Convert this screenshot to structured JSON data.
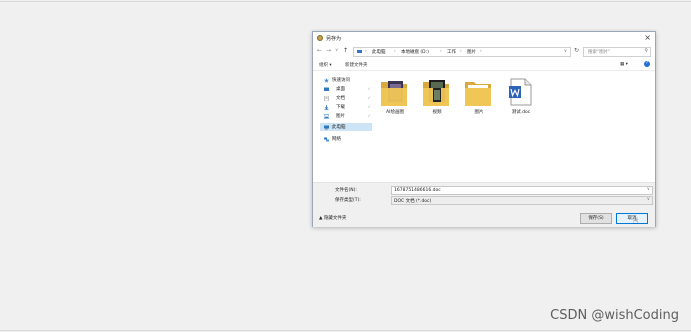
{
  "dialog": {
    "title": "另存为",
    "close_glyph": "×"
  },
  "navbar": {
    "back": "←",
    "forward": "→",
    "dropdown": "∨",
    "up": "↑",
    "crumbs": [
      "此电脑",
      "本地磁盘 (D:)",
      "工作",
      "图片"
    ],
    "separator": "›",
    "refresh": "↻",
    "search_placeholder": "搜索\"图片\"",
    "search_icon": "⚲"
  },
  "toolbar": {
    "organize": "组织 ▾",
    "new_folder": "新建文件夹",
    "view": "▦ ▾",
    "help": "?"
  },
  "nav_pane": {
    "quick_access": "快速访问",
    "items": [
      {
        "label": "桌面",
        "pin": "✓"
      },
      {
        "label": "文档",
        "pin": "✓"
      },
      {
        "label": "下载",
        "pin": "✓"
      },
      {
        "label": "图片",
        "pin": "✓"
      }
    ],
    "this_pc": "此电脑",
    "network": "网络"
  },
  "files": [
    {
      "name": "AI绘画图",
      "type": "folder-images"
    },
    {
      "name": "视频",
      "type": "folder-film"
    },
    {
      "name": "图片",
      "type": "folder"
    },
    {
      "name": "测试.doc",
      "type": "word-doc"
    }
  ],
  "form": {
    "filename_label": "文件名(N):",
    "filename_value": "1678751486616.doc",
    "filetype_label": "保存类型(T):",
    "filetype_value": "DOC 文档 (*.doc)",
    "hide_folders": "隐藏文件夹",
    "save_button": "保存(S)",
    "cancel_button": "取消"
  },
  "watermark": "CSDN @wishCoding",
  "colors": {
    "accent": "#0078d7",
    "folder": "#e8c15a",
    "selection": "#cde4f7"
  }
}
